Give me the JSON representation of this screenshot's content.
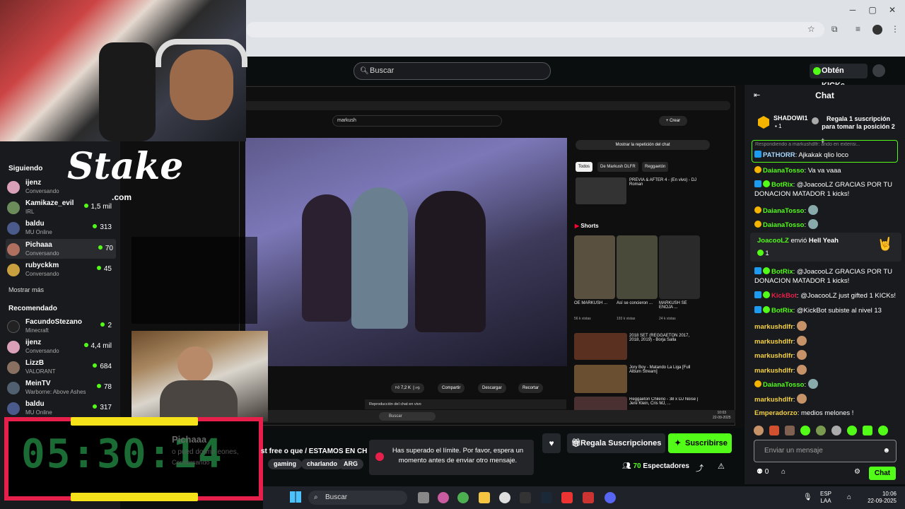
{
  "search": {
    "placeholder": "Buscar"
  },
  "header": {
    "kicks_label": "Obtén KICKs"
  },
  "stake": {
    "logo_text": "Stake",
    "com": ".com"
  },
  "sidebar": {
    "following_title": "Siguiendo",
    "following": [
      {
        "name": "ijenz",
        "sub": "Conversando",
        "viewers": ""
      },
      {
        "name": "Kamikaze_evil",
        "sub": "IRL",
        "viewers": "1,5 mil"
      },
      {
        "name": "baldu",
        "sub": "MU Online",
        "viewers": "313"
      },
      {
        "name": "Pichaaa",
        "sub": "Conversando",
        "viewers": "70"
      },
      {
        "name": "rubyckkm",
        "sub": "Conversando",
        "viewers": "45"
      }
    ],
    "show_more": "Mostrar más",
    "recommended_title": "Recomendado",
    "recommended": [
      {
        "name": "FacundoStezano",
        "sub": "Minecraft",
        "viewers": "2"
      },
      {
        "name": "ijenz",
        "sub": "Conversando",
        "viewers": "4,4 mil"
      },
      {
        "name": "LizzB",
        "sub": "VALORANT",
        "viewers": "684"
      },
      {
        "name": "MeinTV",
        "sub": "Warborne: Above Ashes",
        "viewers": "78"
      },
      {
        "name": "baldu",
        "sub": "MU Online",
        "viewers": "317"
      }
    ]
  },
  "timer": {
    "digits": "05:30:14"
  },
  "inner_youtube": {
    "search_value": "markush",
    "create_label": "Crear",
    "chat_replay": "Mostrar la repetición del chat",
    "filters": [
      "Todos",
      "De Markush DLFR",
      "Reggaetón"
    ],
    "shorts_label": "Shorts",
    "like_count": "7,2 K",
    "share": "Compartir",
    "download": "Descargar",
    "clip": "Recortar",
    "live_chat_replay": "Reproducción del chat en vivo",
    "related": [
      {
        "title": "PREVIA & AFTER 4 - (En vivo) - DJ Roman"
      },
      {
        "title": "2018 SET (REGGAETON 2017, 2018, 2019) - Borja Salla"
      },
      {
        "title": "Jory Boy - Matando La Liga [Full Album Stream]"
      },
      {
        "title": "Reggaeton Chileno - 38 x DJ Noise | Jere Klein, Cris MJ, ..."
      }
    ],
    "shorts": [
      {
        "title": "OE MARKUSH ...",
        "views": "56 k vistas"
      },
      {
        "title": "Así se concieron ...",
        "views": "193 k vistas"
      },
      {
        "title": "MARKUSH SE ENOJA ...",
        "views": "24 k vistas"
      }
    ]
  },
  "stream_info": {
    "streamer": "Pichaaa",
    "title_fragment": "st free o que / ESTAMOS EN CHIL",
    "title_left_fragment": "o pued  dormir  eones,",
    "category": "Conversando",
    "tags": [
      "gaming",
      "charlando",
      "ARG"
    ],
    "viewers": "70",
    "viewers_label": "Espectadores",
    "gift_label": "Regala Suscripciones",
    "subscribe_label": "Suscribirse"
  },
  "toast": {
    "message": "Has superado el límite. Por favor, espera un momento antes de enviar otro mensaje."
  },
  "chat": {
    "title": "Chat",
    "pinned_user": "SHADOWI1",
    "pinned_count": "1",
    "pinned_text": "Regala 1 suscripción para tomar la posición 2",
    "reply_hint": "Respondiendo a markushdlfr: ando en extensi...",
    "messages": [
      {
        "user": "PATHORR",
        "text": "Ajkakak qlio loco",
        "color": "#a8d8ff"
      },
      {
        "user": "DaianaTosso",
        "text": "Va va vaaa",
        "color": "#53fc18"
      },
      {
        "user": "BotRix",
        "text": "@JoacooLZ GRACIAS POR TU DONACION MATADOR 1 kicks!",
        "color": "#53fc18"
      },
      {
        "user": "DaianaTosso",
        "text": "",
        "color": "#53fc18"
      },
      {
        "user": "DaianaTosso",
        "text": "",
        "color": "#53fc18"
      }
    ],
    "gift": {
      "user": "JoacooLZ",
      "action": "envió",
      "item": "Hell Yeah",
      "count": "1"
    },
    "messages2": [
      {
        "user": "BotRix",
        "text": "@JoacooLZ GRACIAS POR TU DONACION MATADOR 1 kicks!",
        "color": "#53fc18"
      },
      {
        "user": "KickBot",
        "text": "@JoacooLZ just gifted 1 KICKs!",
        "color": "#e6204a"
      },
      {
        "user": "BotRix",
        "text": "@KickBot subiste al nivel 13",
        "color": "#53fc18"
      },
      {
        "user": "markushdlfr",
        "text": "",
        "color": "#f5d142"
      },
      {
        "user": "markushdlfr",
        "text": "",
        "color": "#f5d142"
      },
      {
        "user": "markushdlfr",
        "text": "",
        "color": "#f5d142"
      },
      {
        "user": "markushdlfr",
        "text": "",
        "color": "#f5d142"
      },
      {
        "user": "DaianaTosso",
        "text": "",
        "color": "#53fc18"
      },
      {
        "user": "markushdlfr",
        "text": "",
        "color": "#f5d142"
      },
      {
        "user": "Emperadorzo",
        "text": "medios melones !",
        "color": "#f5d142"
      }
    ],
    "input_placeholder": "Enviar un mensaje",
    "kicks_count": "0",
    "send_label": "Chat"
  },
  "taskbar": {
    "search": "Buscar",
    "lang": "ESP",
    "lang2": "LAA",
    "time": "10:06",
    "date": "22-09-2025"
  },
  "inner_taskbar": {
    "search": "Buscar",
    "time": "10:03",
    "date": "22-09-2025"
  },
  "colors": {
    "kick_green": "#53fc18",
    "timer_border": "#e6204a",
    "timer_digits": "#1b6b35"
  }
}
